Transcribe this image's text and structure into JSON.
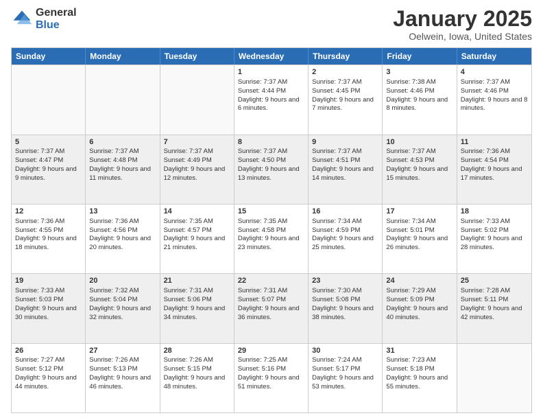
{
  "logo": {
    "general": "General",
    "blue": "Blue"
  },
  "header": {
    "month": "January 2025",
    "location": "Oelwein, Iowa, United States"
  },
  "days": [
    "Sunday",
    "Monday",
    "Tuesday",
    "Wednesday",
    "Thursday",
    "Friday",
    "Saturday"
  ],
  "rows": [
    [
      {
        "day": "",
        "sunrise": "",
        "sunset": "",
        "daylight": "",
        "empty": true
      },
      {
        "day": "",
        "sunrise": "",
        "sunset": "",
        "daylight": "",
        "empty": true
      },
      {
        "day": "",
        "sunrise": "",
        "sunset": "",
        "daylight": "",
        "empty": true
      },
      {
        "day": "1",
        "sunrise": "Sunrise: 7:37 AM",
        "sunset": "Sunset: 4:44 PM",
        "daylight": "Daylight: 9 hours and 6 minutes."
      },
      {
        "day": "2",
        "sunrise": "Sunrise: 7:37 AM",
        "sunset": "Sunset: 4:45 PM",
        "daylight": "Daylight: 9 hours and 7 minutes."
      },
      {
        "day": "3",
        "sunrise": "Sunrise: 7:38 AM",
        "sunset": "Sunset: 4:46 PM",
        "daylight": "Daylight: 9 hours and 8 minutes."
      },
      {
        "day": "4",
        "sunrise": "Sunrise: 7:37 AM",
        "sunset": "Sunset: 4:46 PM",
        "daylight": "Daylight: 9 hours and 8 minutes."
      }
    ],
    [
      {
        "day": "5",
        "sunrise": "Sunrise: 7:37 AM",
        "sunset": "Sunset: 4:47 PM",
        "daylight": "Daylight: 9 hours and 9 minutes."
      },
      {
        "day": "6",
        "sunrise": "Sunrise: 7:37 AM",
        "sunset": "Sunset: 4:48 PM",
        "daylight": "Daylight: 9 hours and 11 minutes."
      },
      {
        "day": "7",
        "sunrise": "Sunrise: 7:37 AM",
        "sunset": "Sunset: 4:49 PM",
        "daylight": "Daylight: 9 hours and 12 minutes."
      },
      {
        "day": "8",
        "sunrise": "Sunrise: 7:37 AM",
        "sunset": "Sunset: 4:50 PM",
        "daylight": "Daylight: 9 hours and 13 minutes."
      },
      {
        "day": "9",
        "sunrise": "Sunrise: 7:37 AM",
        "sunset": "Sunset: 4:51 PM",
        "daylight": "Daylight: 9 hours and 14 minutes."
      },
      {
        "day": "10",
        "sunrise": "Sunrise: 7:37 AM",
        "sunset": "Sunset: 4:53 PM",
        "daylight": "Daylight: 9 hours and 15 minutes."
      },
      {
        "day": "11",
        "sunrise": "Sunrise: 7:36 AM",
        "sunset": "Sunset: 4:54 PM",
        "daylight": "Daylight: 9 hours and 17 minutes."
      }
    ],
    [
      {
        "day": "12",
        "sunrise": "Sunrise: 7:36 AM",
        "sunset": "Sunset: 4:55 PM",
        "daylight": "Daylight: 9 hours and 18 minutes."
      },
      {
        "day": "13",
        "sunrise": "Sunrise: 7:36 AM",
        "sunset": "Sunset: 4:56 PM",
        "daylight": "Daylight: 9 hours and 20 minutes."
      },
      {
        "day": "14",
        "sunrise": "Sunrise: 7:35 AM",
        "sunset": "Sunset: 4:57 PM",
        "daylight": "Daylight: 9 hours and 21 minutes."
      },
      {
        "day": "15",
        "sunrise": "Sunrise: 7:35 AM",
        "sunset": "Sunset: 4:58 PM",
        "daylight": "Daylight: 9 hours and 23 minutes."
      },
      {
        "day": "16",
        "sunrise": "Sunrise: 7:34 AM",
        "sunset": "Sunset: 4:59 PM",
        "daylight": "Daylight: 9 hours and 25 minutes."
      },
      {
        "day": "17",
        "sunrise": "Sunrise: 7:34 AM",
        "sunset": "Sunset: 5:01 PM",
        "daylight": "Daylight: 9 hours and 26 minutes."
      },
      {
        "day": "18",
        "sunrise": "Sunrise: 7:33 AM",
        "sunset": "Sunset: 5:02 PM",
        "daylight": "Daylight: 9 hours and 28 minutes."
      }
    ],
    [
      {
        "day": "19",
        "sunrise": "Sunrise: 7:33 AM",
        "sunset": "Sunset: 5:03 PM",
        "daylight": "Daylight: 9 hours and 30 minutes."
      },
      {
        "day": "20",
        "sunrise": "Sunrise: 7:32 AM",
        "sunset": "Sunset: 5:04 PM",
        "daylight": "Daylight: 9 hours and 32 minutes."
      },
      {
        "day": "21",
        "sunrise": "Sunrise: 7:31 AM",
        "sunset": "Sunset: 5:06 PM",
        "daylight": "Daylight: 9 hours and 34 minutes."
      },
      {
        "day": "22",
        "sunrise": "Sunrise: 7:31 AM",
        "sunset": "Sunset: 5:07 PM",
        "daylight": "Daylight: 9 hours and 36 minutes."
      },
      {
        "day": "23",
        "sunrise": "Sunrise: 7:30 AM",
        "sunset": "Sunset: 5:08 PM",
        "daylight": "Daylight: 9 hours and 38 minutes."
      },
      {
        "day": "24",
        "sunrise": "Sunrise: 7:29 AM",
        "sunset": "Sunset: 5:09 PM",
        "daylight": "Daylight: 9 hours and 40 minutes."
      },
      {
        "day": "25",
        "sunrise": "Sunrise: 7:28 AM",
        "sunset": "Sunset: 5:11 PM",
        "daylight": "Daylight: 9 hours and 42 minutes."
      }
    ],
    [
      {
        "day": "26",
        "sunrise": "Sunrise: 7:27 AM",
        "sunset": "Sunset: 5:12 PM",
        "daylight": "Daylight: 9 hours and 44 minutes."
      },
      {
        "day": "27",
        "sunrise": "Sunrise: 7:26 AM",
        "sunset": "Sunset: 5:13 PM",
        "daylight": "Daylight: 9 hours and 46 minutes."
      },
      {
        "day": "28",
        "sunrise": "Sunrise: 7:26 AM",
        "sunset": "Sunset: 5:15 PM",
        "daylight": "Daylight: 9 hours and 48 minutes."
      },
      {
        "day": "29",
        "sunrise": "Sunrise: 7:25 AM",
        "sunset": "Sunset: 5:16 PM",
        "daylight": "Daylight: 9 hours and 51 minutes."
      },
      {
        "day": "30",
        "sunrise": "Sunrise: 7:24 AM",
        "sunset": "Sunset: 5:17 PM",
        "daylight": "Daylight: 9 hours and 53 minutes."
      },
      {
        "day": "31",
        "sunrise": "Sunrise: 7:23 AM",
        "sunset": "Sunset: 5:18 PM",
        "daylight": "Daylight: 9 hours and 55 minutes."
      },
      {
        "day": "",
        "sunrise": "",
        "sunset": "",
        "daylight": "",
        "empty": true
      }
    ]
  ]
}
